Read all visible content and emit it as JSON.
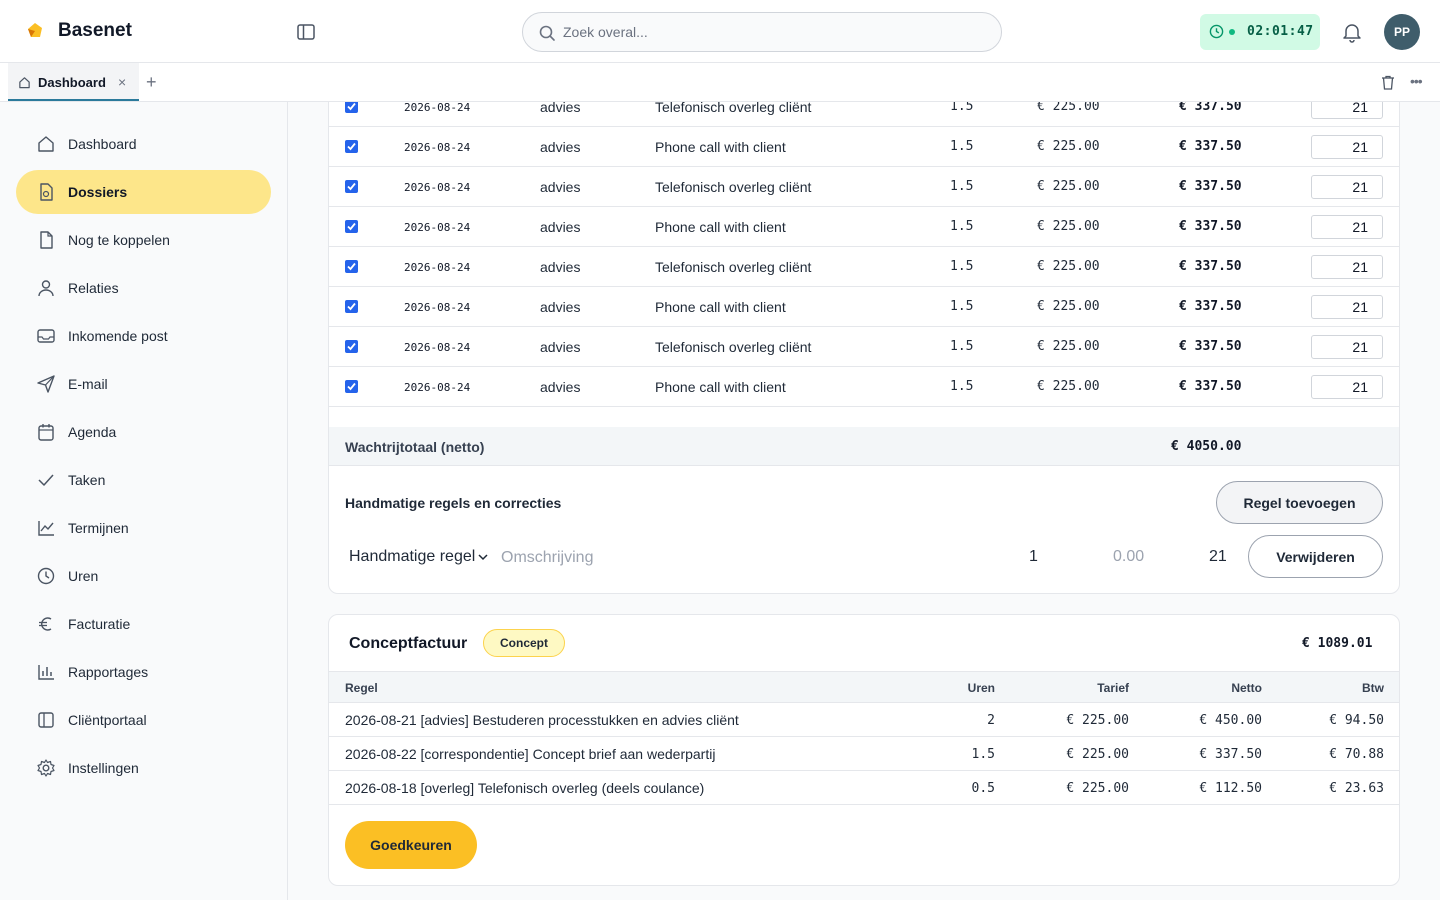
{
  "app": {
    "brand": "Basenet",
    "brand_color": "#fbbf24",
    "accent": "#2b7a9b"
  },
  "header": {
    "search_placeholder": "Zoek overal...",
    "timer": "02:01:47",
    "avatar_initials": "PP"
  },
  "tabs": {
    "active_label": "Dashboard",
    "close": "×",
    "new": "+",
    "more": "•••"
  },
  "sidebar": {
    "items": [
      {
        "label": "Dashboard",
        "icon": "home-icon",
        "active": false
      },
      {
        "label": "Dossiers",
        "icon": "file-icon",
        "active": true
      },
      {
        "label": "Nog te koppelen",
        "icon": "document-icon",
        "active": false
      },
      {
        "label": "Relaties",
        "icon": "user-icon",
        "active": false
      },
      {
        "label": "Inkomende post",
        "icon": "inbox-icon",
        "active": false
      },
      {
        "label": "E-mail",
        "icon": "send-icon",
        "active": false
      },
      {
        "label": "Agenda",
        "icon": "calendar-icon",
        "active": false
      },
      {
        "label": "Taken",
        "icon": "check-icon",
        "active": false
      },
      {
        "label": "Termijnen",
        "icon": "chart-line-icon",
        "active": false
      },
      {
        "label": "Uren",
        "icon": "clock-icon",
        "active": false
      },
      {
        "label": "Facturatie",
        "icon": "euro-icon",
        "active": false
      },
      {
        "label": "Rapportages",
        "icon": "bar-chart-icon",
        "active": false
      },
      {
        "label": "Cliëntportaal",
        "icon": "panel-icon",
        "active": false
      },
      {
        "label": "Instellingen",
        "icon": "gear-icon",
        "active": false
      }
    ]
  },
  "queue": {
    "rows": [
      {
        "date": "2026-08-24",
        "activity": "advies",
        "description": "Telefonisch overleg cliënt",
        "hours": "1.5",
        "rate": "€ 225.00",
        "net": "€ 337.50",
        "vat": "21",
        "checked": true
      },
      {
        "date": "2026-08-24",
        "activity": "advies",
        "description": "Phone call with client",
        "hours": "1.5",
        "rate": "€ 225.00",
        "net": "€ 337.50",
        "vat": "21",
        "checked": true
      },
      {
        "date": "2026-08-24",
        "activity": "advies",
        "description": "Telefonisch overleg cliënt",
        "hours": "1.5",
        "rate": "€ 225.00",
        "net": "€ 337.50",
        "vat": "21",
        "checked": true
      },
      {
        "date": "2026-08-24",
        "activity": "advies",
        "description": "Phone call with client",
        "hours": "1.5",
        "rate": "€ 225.00",
        "net": "€ 337.50",
        "vat": "21",
        "checked": true
      },
      {
        "date": "2026-08-24",
        "activity": "advies",
        "description": "Telefonisch overleg cliënt",
        "hours": "1.5",
        "rate": "€ 225.00",
        "net": "€ 337.50",
        "vat": "21",
        "checked": true
      },
      {
        "date": "2026-08-24",
        "activity": "advies",
        "description": "Phone call with client",
        "hours": "1.5",
        "rate": "€ 225.00",
        "net": "€ 337.50",
        "vat": "21",
        "checked": true
      },
      {
        "date": "2026-08-24",
        "activity": "advies",
        "description": "Telefonisch overleg cliënt",
        "hours": "1.5",
        "rate": "€ 225.00",
        "net": "€ 337.50",
        "vat": "21",
        "checked": true
      },
      {
        "date": "2026-08-24",
        "activity": "advies",
        "description": "Phone call with client",
        "hours": "1.5",
        "rate": "€ 225.00",
        "net": "€ 337.50",
        "vat": "21",
        "checked": true
      }
    ],
    "total_label": "Wachtrijtotaal (netto)",
    "total_value": "€ 4050.00"
  },
  "manual": {
    "title": "Handmatige regels en correcties",
    "add_button": "Regel toevoegen",
    "type_select": "Handmatige regel",
    "description_placeholder": "Omschrijving",
    "qty": "1",
    "rate": "0.00",
    "vat": "21",
    "delete_button": "Verwijderen"
  },
  "invoice": {
    "title": "Conceptfactuur",
    "badge": "Concept",
    "total": "€ 1089.01",
    "columns": {
      "regel": "Regel",
      "uren": "Uren",
      "tarief": "Tarief",
      "netto": "Netto",
      "btw": "Btw"
    },
    "lines": [
      {
        "desc": "2026-08-21 [advies] Bestuderen processtukken en advies cliënt",
        "hours": "2",
        "rate": "€ 225.00",
        "net": "€ 450.00",
        "vat": "€ 94.50"
      },
      {
        "desc": "2026-08-22 [correspondentie] Concept brief aan wederpartij",
        "hours": "1.5",
        "rate": "€ 225.00",
        "net": "€ 337.50",
        "vat": "€ 70.88"
      },
      {
        "desc": "2026-08-18 [overleg] Telefonisch overleg (deels coulance)",
        "hours": "0.5",
        "rate": "€ 225.00",
        "net": "€ 112.50",
        "vat": "€ 23.63"
      }
    ],
    "approve_button": "Goedkeuren"
  }
}
